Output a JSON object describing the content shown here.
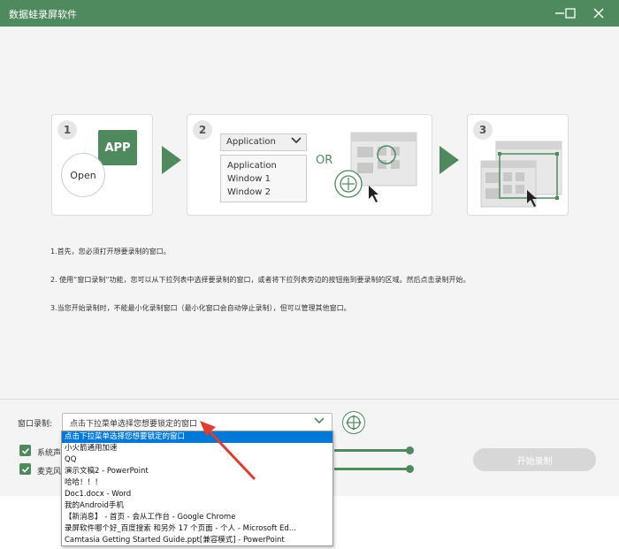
{
  "window": {
    "title": "数据蛙录屏软件",
    "controls": [
      "minimize-icon",
      "maximize-icon",
      "close-icon"
    ]
  },
  "steps": {
    "step1": {
      "number": "1",
      "app_label": "APP",
      "open_label": "Open"
    },
    "step2": {
      "number": "2",
      "dropdown_label": "Application",
      "list_items": [
        "Application",
        "Window 1",
        "Window 2"
      ],
      "or_label": "OR"
    },
    "step3": {
      "number": "3"
    }
  },
  "instructions": [
    "1.首先，您必须打开想要录制的窗口。",
    "2. 使用“窗口录制”功能，您可以从下拉列表中选择要录制的窗口，或者将下拉列表旁边的按钮拖到要录制的区域。然后点击录制开始。",
    "3.当您开始录制时，不能最小化录制窗口（最小化窗口会自动停止录制），但可以管理其他窗口。"
  ],
  "controls": {
    "window_record_label": "窗口录制:",
    "select_value": "点击下拉菜单选择您想要锁定的窗口",
    "system_sound_label": "系统声",
    "mic_label": "麦克风",
    "system_sound_checked": true,
    "mic_checked": true,
    "start_button": "开始录制"
  },
  "dropdown": {
    "options": [
      "点击下拉菜单选择您想要锁定的窗口",
      "小火箭通用加速",
      "QQ",
      "演示文稿2 - PowerPoint",
      "哈哈！！！",
      "Doc1.docx - Word",
      "我的Android手机",
      "【新消息】 - 首页 - 会从工作台 - Google Chrome",
      "录屏软件哪个好_百度搜索 和另外 17 个页面 - 个人 - Microsoft Ed...",
      "Camtasia Getting Started Guide.ppt[兼容模式] - PowerPoint"
    ],
    "selected_index": 0
  },
  "colors": {
    "accent": "#4f8a5e",
    "selection": "#0078d7",
    "annotation_arrow": "#e03c31"
  }
}
